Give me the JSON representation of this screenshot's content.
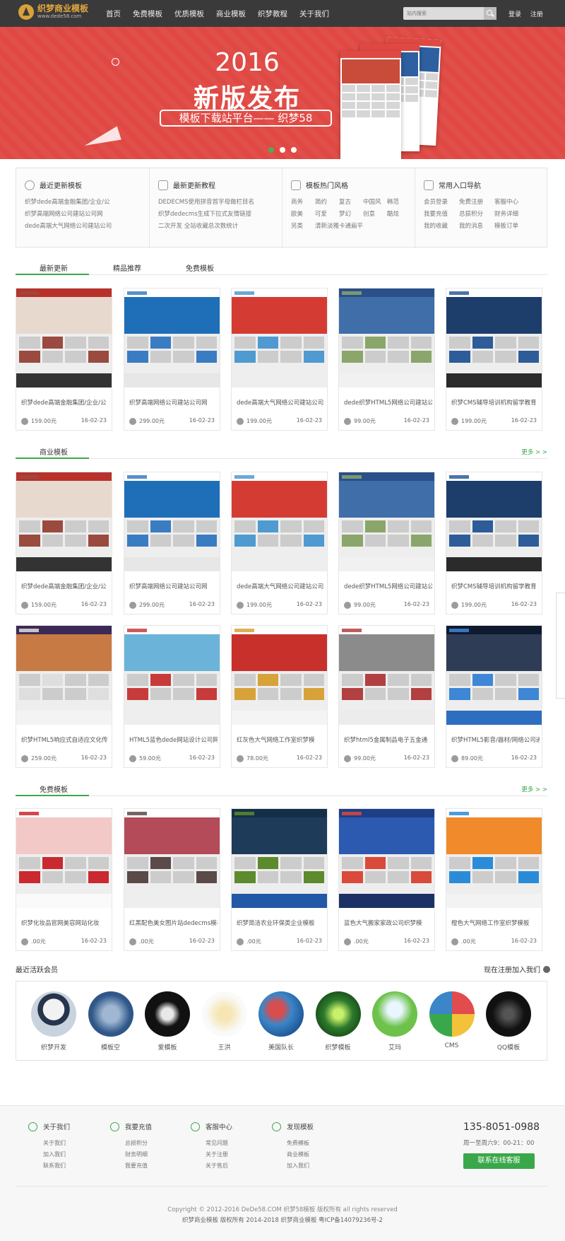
{
  "header": {
    "logo_title": "织梦商业模板",
    "logo_url": "www.dede58.com",
    "nav": [
      "首页",
      "免费模板",
      "优质模板",
      "商业模板",
      "织梦教程",
      "关于我们"
    ],
    "search_placeholder": "站内搜索",
    "login": "登录",
    "register": "注册"
  },
  "banner": {
    "year": "2016",
    "title": "新版发布",
    "subtitle": "模板下载站平台—— 织梦58"
  },
  "info": [
    {
      "title": "最近更新模板",
      "links": [
        "织梦dede高端金融集团/企业/公",
        "织梦高端网络公司建站公司网",
        "dede高端大气网络公司建站公司"
      ]
    },
    {
      "title": "最新更新教程",
      "links": [
        "DEDECMS使用拼音首字母做栏目名",
        "织梦dedecms生成下拉式友情链接",
        "二次开发 全站收藏总次数统计"
      ]
    },
    {
      "title": "模板热门风格",
      "tags": [
        "商务",
        "简约",
        "复古",
        "中国风",
        "韩范",
        "欧美",
        "可爱",
        "梦幻",
        "创意",
        "酷炫",
        "另类",
        "清新淡雅",
        "卡通扁平"
      ]
    },
    {
      "title": "常用入口导航",
      "tags": [
        "会员登录",
        "免费注册",
        "客服中心",
        "我要充值",
        "总损积分",
        "财务详细",
        "我的收藏",
        "我的消息",
        "模板订单"
      ]
    }
  ],
  "tabs": [
    "最新更新",
    "精品推荐",
    "免费模板"
  ],
  "sections": {
    "business": "商业模板",
    "free": "免费模板",
    "more": "更多 > >"
  },
  "cards_latest": [
    {
      "title": "织梦dede高端金融集团/企业/公",
      "price": "159.00元",
      "date": "16-02-23"
    },
    {
      "title": "织梦高端网络公司建站公司网",
      "price": "299.00元",
      "date": "16-02-23"
    },
    {
      "title": "dede高端大气网络公司建站公司",
      "price": "199.00元",
      "date": "16-02-23"
    },
    {
      "title": "dede织梦HTML5网络公司建站公",
      "price": "99.00元",
      "date": "16-02-23"
    },
    {
      "title": "织梦CMS辅导培训机构留学教育",
      "price": "199.00元",
      "date": "16-02-23"
    }
  ],
  "cards_business": [
    {
      "title": "织梦dede高端金融集团/企业/公",
      "price": "159.00元",
      "date": "16-02-23"
    },
    {
      "title": "织梦高端网络公司建站公司网",
      "price": "299.00元",
      "date": "16-02-23"
    },
    {
      "title": "dede高端大气网络公司建站公司",
      "price": "199.00元",
      "date": "16-02-23"
    },
    {
      "title": "dede织梦HTML5网络公司建站公",
      "price": "99.00元",
      "date": "16-02-23"
    },
    {
      "title": "织梦CMS辅导培训机构留学教育",
      "price": "199.00元",
      "date": "16-02-23"
    },
    {
      "title": "织梦HTML5响应式自适应文化传",
      "price": "259.00元",
      "date": "16-02-23"
    },
    {
      "title": "HTML5蓝色dede网站设计公司网",
      "price": "59.00元",
      "date": "16-02-23"
    },
    {
      "title": "红灰色大气网络工作室织梦模",
      "price": "78.00元",
      "date": "16-02-23"
    },
    {
      "title": "织梦html5金属制品电子五金通",
      "price": "99.00元",
      "date": "16-02-23"
    },
    {
      "title": "织梦HTML5影音/器材/网络公司通",
      "price": "89.00元",
      "date": "16-02-23"
    }
  ],
  "cards_free": [
    {
      "title": "织梦化妆品官网美容网站化妆",
      "price": ".00元",
      "date": "16-02-23"
    },
    {
      "title": "红黑配色美女图片站dedecms模板",
      "price": ".00元",
      "date": "16-02-23"
    },
    {
      "title": "织梦简洁农业环保类企业模板",
      "price": ".00元",
      "date": "16-02-23"
    },
    {
      "title": "蓝色大气搬家家政公司织梦模",
      "price": ".00元",
      "date": "16-02-23"
    },
    {
      "title": "橙色大气网络工作室织梦模板",
      "price": ".00元",
      "date": "16-02-23"
    }
  ],
  "members": {
    "title": "最近活跃会员",
    "join": "现在注册加入我们",
    "list": [
      "织梦开发",
      "模板空",
      "爱模板",
      "王洪",
      "美国队长",
      "织梦模板",
      "艾玛",
      "CMS",
      "QQ模板"
    ]
  },
  "footer": {
    "cols": [
      {
        "title": "关于我们",
        "links": [
          "关于我们",
          "加入我们",
          "联系我们"
        ]
      },
      {
        "title": "我要充值",
        "links": [
          "总损积分",
          "财务明细",
          "我要充值"
        ]
      },
      {
        "title": "客服中心",
        "links": [
          "常见问题",
          "关于注册",
          "关于售后"
        ]
      },
      {
        "title": "发现模板",
        "links": [
          "免费模板",
          "商业模板",
          "加入我们"
        ]
      }
    ],
    "phone": "135-8051-0988",
    "hours": "周一至周六9：00-21：00",
    "cs_button": "联系在线客服",
    "copyright": "Copyright © 2012-2016 DeDe58.COM 织梦58模板 版权所有 all rights reserved",
    "icp": "织梦商业模板 版权所有 2014-2018 织梦商业模板 粤ICP备14079236号-2"
  },
  "colors": {
    "accent": "#3aa84a",
    "banner": "#e04943",
    "header": "#3a3a3a"
  }
}
